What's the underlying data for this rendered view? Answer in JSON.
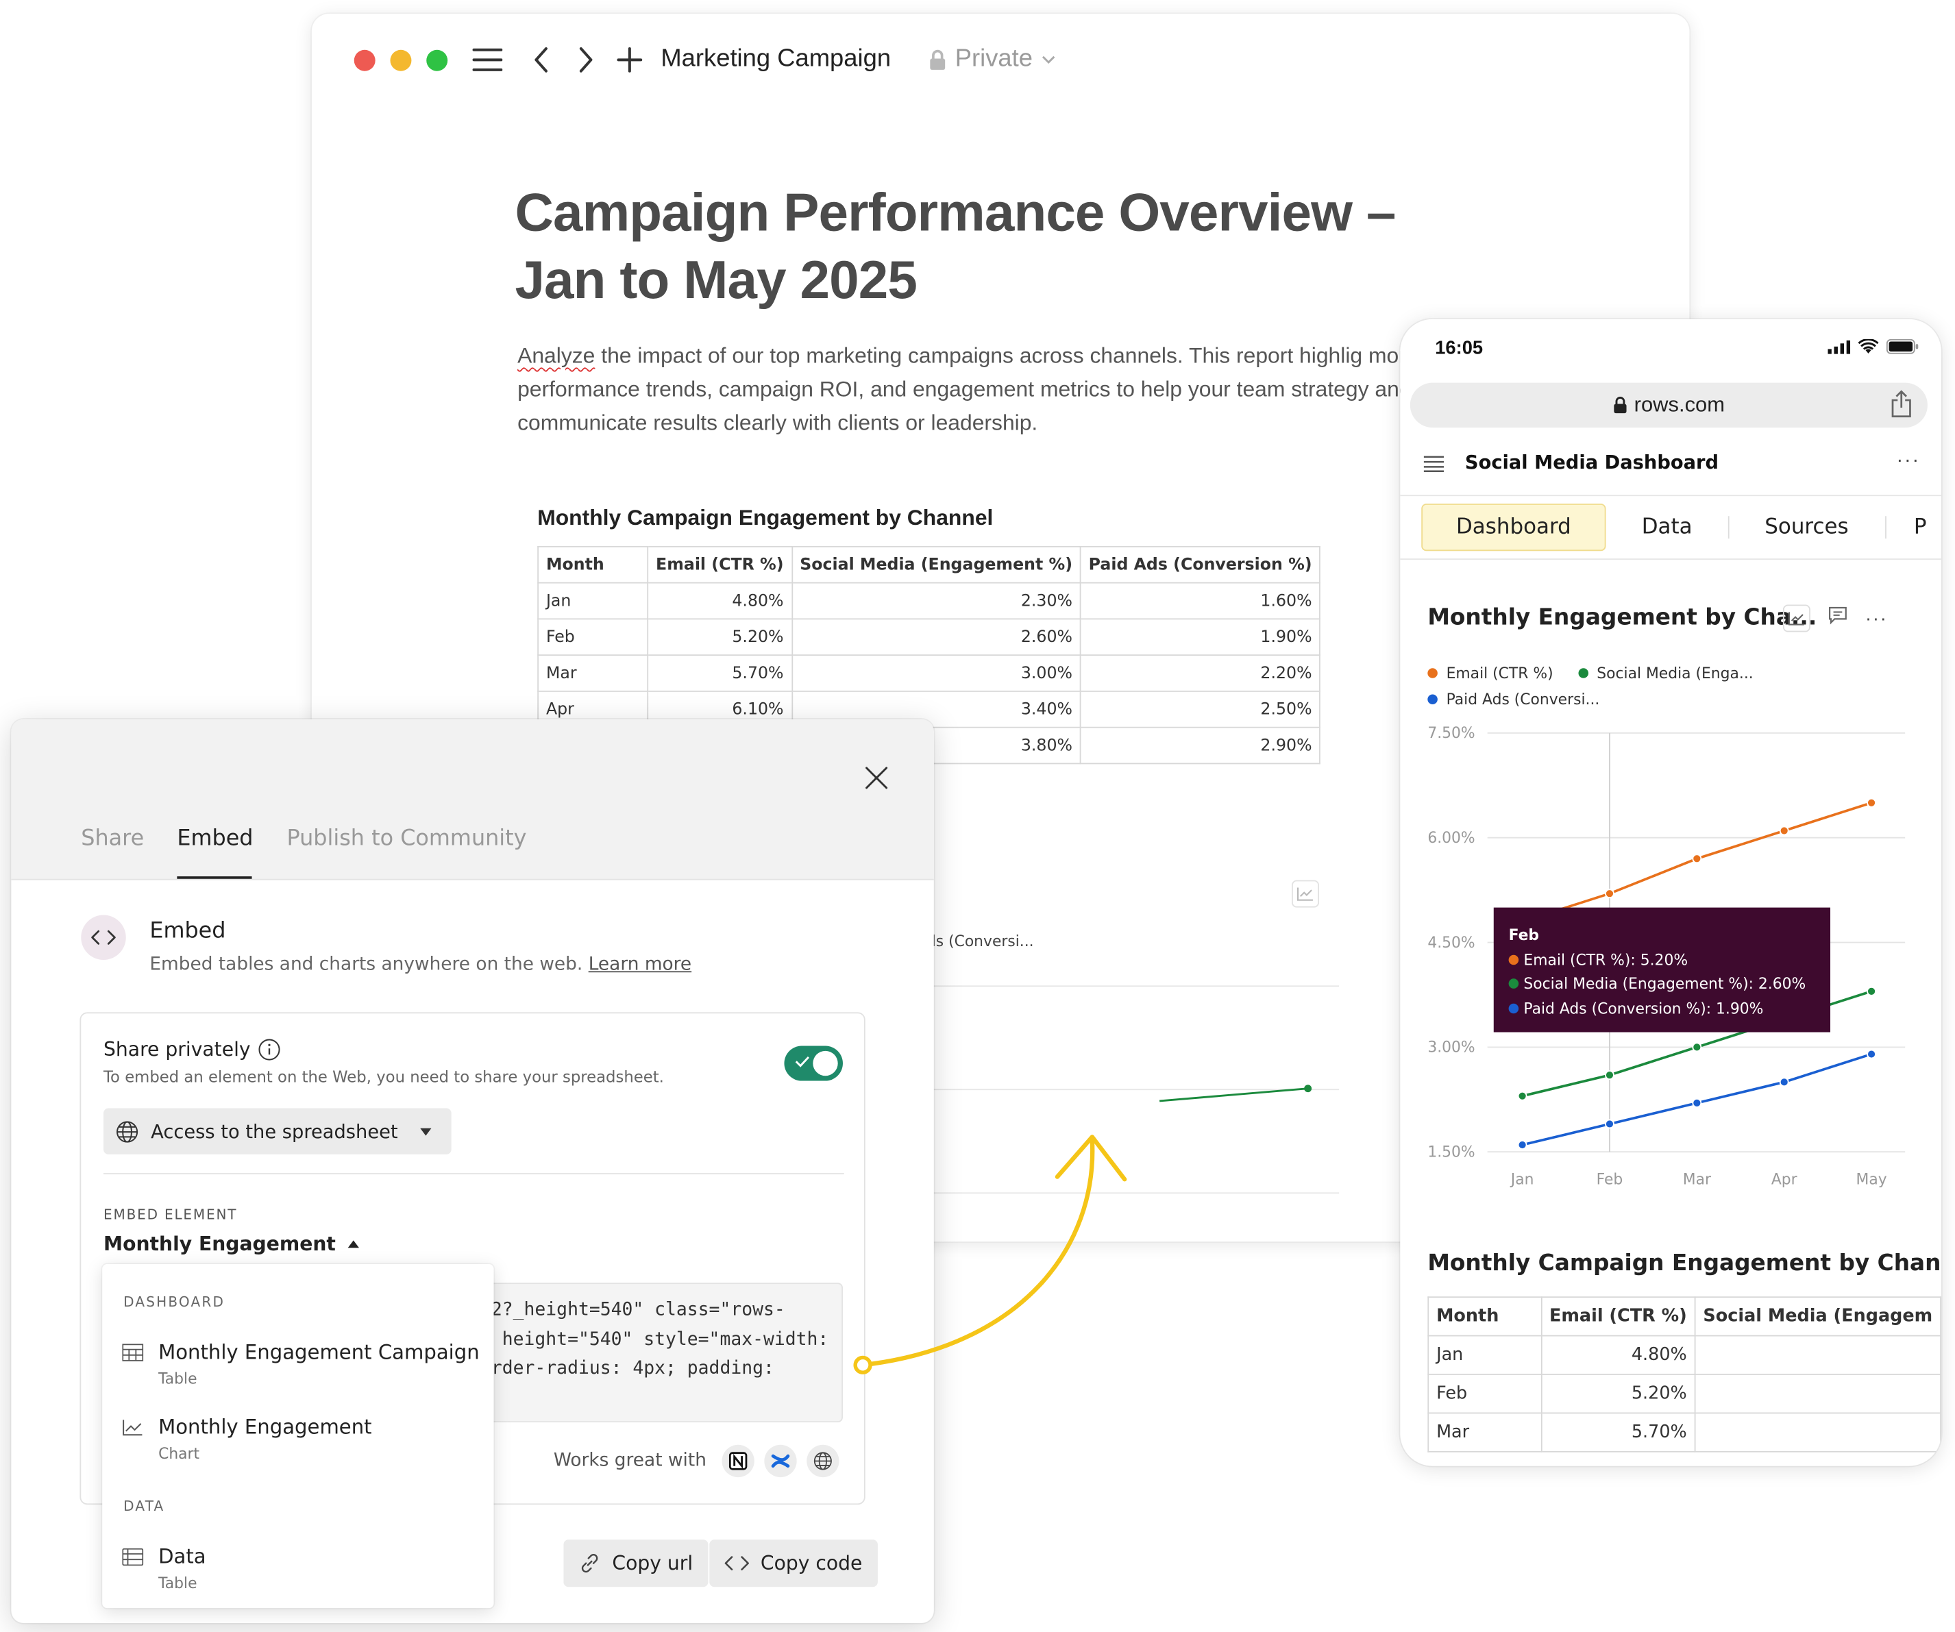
{
  "window": {
    "doc_name": "Marketing Campaign",
    "privacy": "Private"
  },
  "doc": {
    "title": "Campaign Performance Overview – Jan to May 2025",
    "desc_first_word": "Analyze",
    "desc_rest": " the impact of our top marketing campaigns across channels. This report highlig monthly performance trends, campaign ROI, and engagement metrics to help your team strategy and communicate results clearly with clients or leadership.",
    "table_title": "Monthly Campaign Engagement by Channel",
    "table_headers": [
      "Month",
      "Email (CTR %)",
      "Social Media (Engagement %)",
      "Paid Ads (Conversion %)"
    ],
    "table_rows": [
      [
        "Jan",
        "4.80%",
        "2.30%",
        "1.60%"
      ],
      [
        "Feb",
        "5.20%",
        "2.60%",
        "1.90%"
      ],
      [
        "Mar",
        "5.70%",
        "3.00%",
        "2.20%"
      ],
      [
        "Apr",
        "6.10%",
        "3.40%",
        "2.50%"
      ],
      [
        "",
        "",
        "3.80%",
        "2.90%"
      ]
    ],
    "legend_fragment": "ds (Conversi..."
  },
  "phone": {
    "time": "16:05",
    "url": "rows.com",
    "app_title": "Social Media Dashboard",
    "more": "···",
    "tabs": [
      "Dashboard",
      "Data",
      "Sources",
      "P"
    ],
    "chart_title": "Monthly Engagement by Cha...",
    "legend": [
      "Email (CTR %)",
      "Social Media (Enga...",
      "Paid Ads (Conversi..."
    ],
    "tooltip": {
      "title": "Feb",
      "lines": [
        "Email (CTR %): 5.20%",
        "Social Media (Engagement %): 2.60%",
        "Paid Ads (Conversion %): 1.90%"
      ]
    },
    "table_title": "Monthly Campaign Engagement by Channel",
    "table_headers": [
      "Month",
      "Email (CTR %)",
      "Social Media (Engagem"
    ],
    "table_rows": [
      [
        "Jan",
        "4.80%",
        ""
      ],
      [
        "Feb",
        "5.20%",
        ""
      ],
      [
        "Mar",
        "5.70%",
        ""
      ]
    ]
  },
  "chart_data": {
    "type": "line",
    "title": "Monthly Engagement by Cha...",
    "categories": [
      "Jan",
      "Feb",
      "Mar",
      "Apr",
      "May"
    ],
    "series": [
      {
        "name": "Email (CTR %)",
        "color": "#e8711c",
        "values": [
          4.8,
          5.2,
          5.7,
          6.1,
          6.5
        ]
      },
      {
        "name": "Social Media (Engagement %)",
        "color": "#1b8a3d",
        "values": [
          2.3,
          2.6,
          3.0,
          3.4,
          3.8
        ]
      },
      {
        "name": "Paid Ads (Conversion %)",
        "color": "#1a5fd1",
        "values": [
          1.6,
          1.9,
          2.2,
          2.5,
          2.9
        ]
      }
    ],
    "y_ticks": [
      "1.50%",
      "3.00%",
      "4.50%",
      "6.00%",
      "7.50%"
    ],
    "ylim": [
      1.5,
      7.5
    ],
    "grid": true,
    "legend": "top-left"
  },
  "modal": {
    "tabs": [
      "Share",
      "Embed",
      "Publish to Community"
    ],
    "embed_title": "Embed",
    "embed_desc": "Embed tables and charts anywhere on the web.",
    "learn_more": "Learn more",
    "share_privately": "Share privately",
    "share_desc": "To embed an element on the Web, you need to share your spreadsheet.",
    "access": "Access to the spreadsheet",
    "embed_element_label": "EMBED ELEMENT",
    "embed_element_value": "Monthly Engagement",
    "code_lines": [
      "2?_height=540\" class=\"rows-",
      " height=\"540\" style=\"max-width:",
      "rder-radius: 4px; padding:"
    ],
    "works_with": "Works great with",
    "copy_url": "Copy url",
    "copy_code": "Copy code",
    "dropdown": {
      "section1": "DASHBOARD",
      "section2": "DATA",
      "items": [
        {
          "label": "Monthly Engagement Campaign",
          "sub": "Table"
        },
        {
          "label": "Monthly Engagement",
          "sub": "Chart"
        },
        {
          "label": "Data",
          "sub": "Table"
        }
      ]
    }
  },
  "colors": {
    "accent_yellow": "#f5c518",
    "toggle_green": "#1f8a6a",
    "tooltip_bg": "#3e0a2e"
  }
}
